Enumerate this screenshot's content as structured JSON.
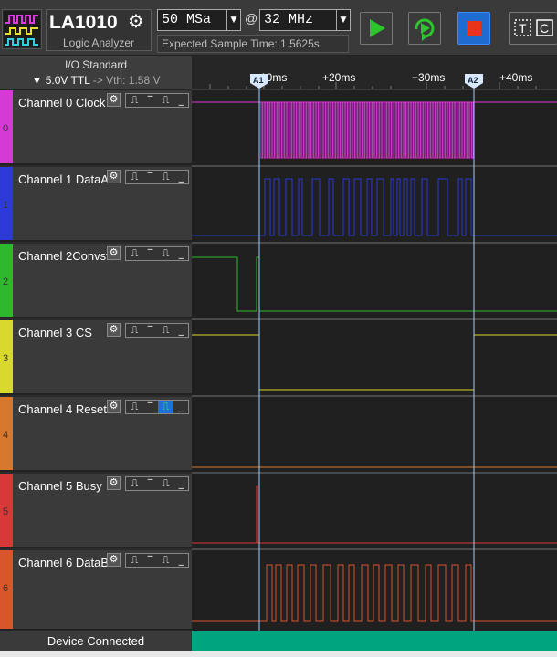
{
  "app": {
    "title": "LA1010",
    "subtitle": "Logic Analyzer"
  },
  "toolbar": {
    "sample_rate": "50 MSa",
    "at_symbol": "@",
    "frequency": "32 MHz",
    "expected_time": "Expected Sample Time: 1.5625s",
    "run_icon": "play-icon",
    "loop_icon": "repeat-run-icon",
    "stop_icon": "stop-icon",
    "text_icon": "text-tool-icon",
    "colors": {
      "run": "#2cc52c",
      "stop": "#e8341c",
      "stop_bg": "#1f6bd0"
    }
  },
  "io": {
    "title": "I/O Standard",
    "standard": "▼ 5.0V TTL",
    "arrow": " -> ",
    "vth": "Vth: 1.58 V"
  },
  "timeline": {
    "ticks": [
      "+10ms",
      "+20ms",
      "+30ms",
      "+40ms"
    ],
    "cursor_a": "A1",
    "cursor_b": "A2"
  },
  "channels": [
    {
      "name": "Channel 0 Clock",
      "index": "0",
      "color": "#d63ad6",
      "trig_active": false
    },
    {
      "name": "Channel 1 DataA",
      "index": "1",
      "color": "#2d39d8",
      "trig_active": false
    },
    {
      "name": "Channel 2Convst",
      "index": "2",
      "color": "#2eb82e",
      "trig_active": false
    },
    {
      "name": "Channel 3 CS",
      "index": "3",
      "color": "#d8d82d",
      "trig_active": false
    },
    {
      "name": "Channel 4 Reset",
      "index": "4",
      "color": "#d8782d",
      "trig_active": true
    },
    {
      "name": "Channel 5 Busy",
      "index": "5",
      "color": "#d83838",
      "trig_active": false
    },
    {
      "name": "Channel 6 DataB",
      "index": "6",
      "color": "#d8552d",
      "trig_active": false
    }
  ],
  "status": {
    "text": "Device Connected",
    "progress": 1.0
  }
}
